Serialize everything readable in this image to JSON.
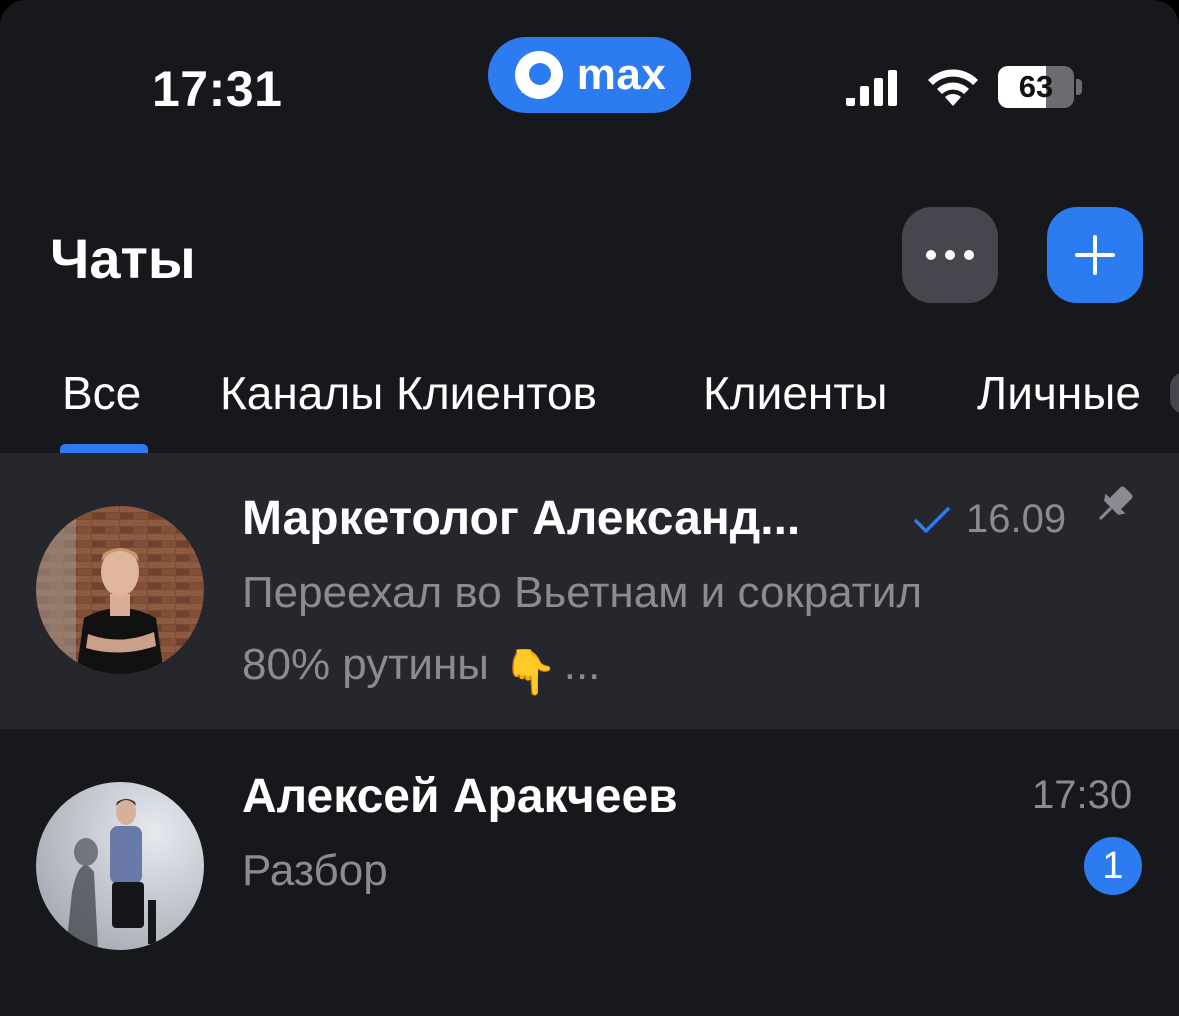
{
  "status_bar": {
    "time": "17:31",
    "app_pill_text": "max",
    "battery_percent": "63",
    "battery_level": 0.63
  },
  "header": {
    "title": "Чаты",
    "more_icon": "ellipsis-icon",
    "add_icon": "plus-icon"
  },
  "tabs": [
    {
      "label": "Все",
      "active": true
    },
    {
      "label": "Каналы Клиентов",
      "active": false
    },
    {
      "label": "Клиенты",
      "active": false
    },
    {
      "label": "Личные",
      "active": false
    }
  ],
  "chats": [
    {
      "name": "Маркетолог Александ...",
      "time": "16.09",
      "read_check": true,
      "pinned": true,
      "preview_line1": "Переехал во Вьетнам и сократил",
      "preview_line2": "80% рутины",
      "preview_emoji": "👇",
      "preview_ellipsis": "..."
    },
    {
      "name": "Алексей Аракчеев",
      "time": "17:30",
      "preview": "Разбор",
      "unread_count": "1"
    }
  ],
  "colors": {
    "accent": "#2d7bf0",
    "background": "#17181c",
    "pinned_row": "#26272d",
    "muted_text": "#8b8c93"
  }
}
